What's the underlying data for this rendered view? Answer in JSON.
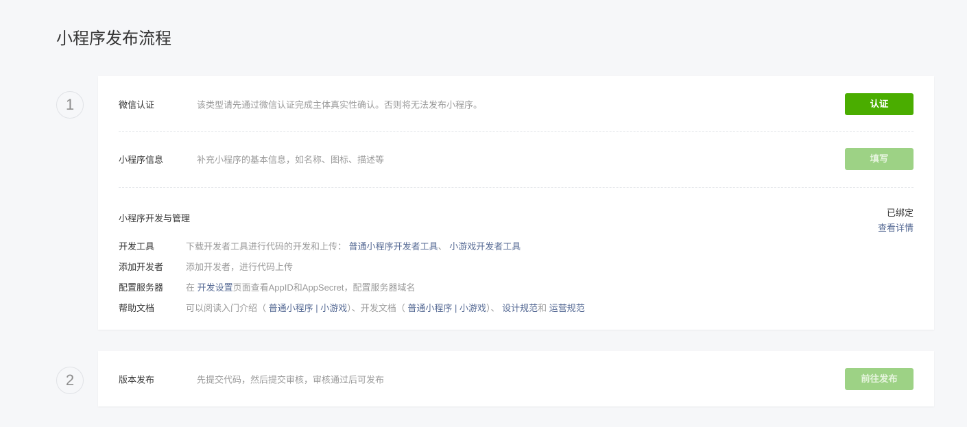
{
  "page_title": "小程序发布流程",
  "steps": [
    {
      "number": "1"
    },
    {
      "number": "2"
    }
  ],
  "verify": {
    "label": "微信认证",
    "desc": "该类型请先通过微信认证完成主体真实性确认。否则将无法发布小程序。",
    "button": "认证"
  },
  "info": {
    "label": "小程序信息",
    "desc": "补充小程序的基本信息，如名称、图标、描述等",
    "button": "填写"
  },
  "dev": {
    "label": "小程序开发与管理",
    "status": "已绑定",
    "detail_link": "查看详情",
    "tools": {
      "label": "开发工具",
      "desc": "下载开发者工具进行代码的开发和上传：",
      "link1": "普通小程序开发者工具",
      "sep": "、",
      "link2": "小游戏开发者工具"
    },
    "add_dev": {
      "label": "添加开发者",
      "desc": "添加开发者，进行代码上传"
    },
    "server": {
      "label": "配置服务器",
      "pre": "在 ",
      "link": "开发设置",
      "post": "页面查看AppID和AppSecret，配置服务器域名"
    },
    "docs": {
      "label": "帮助文档",
      "t1": "可以阅读入门介绍（ ",
      "l1": "普通小程序",
      "bar": " | ",
      "l2": "小游戏",
      "t2": "）、开发文档（ ",
      "l3": "普通小程序",
      "l4": "小游戏",
      "t3": "）、 ",
      "l5": "设计规范",
      "t4": "和 ",
      "l6": "运营规范"
    }
  },
  "release": {
    "label": "版本发布",
    "desc": "先提交代码，然后提交审核，审核通过后可发布",
    "button": "前往发布"
  }
}
